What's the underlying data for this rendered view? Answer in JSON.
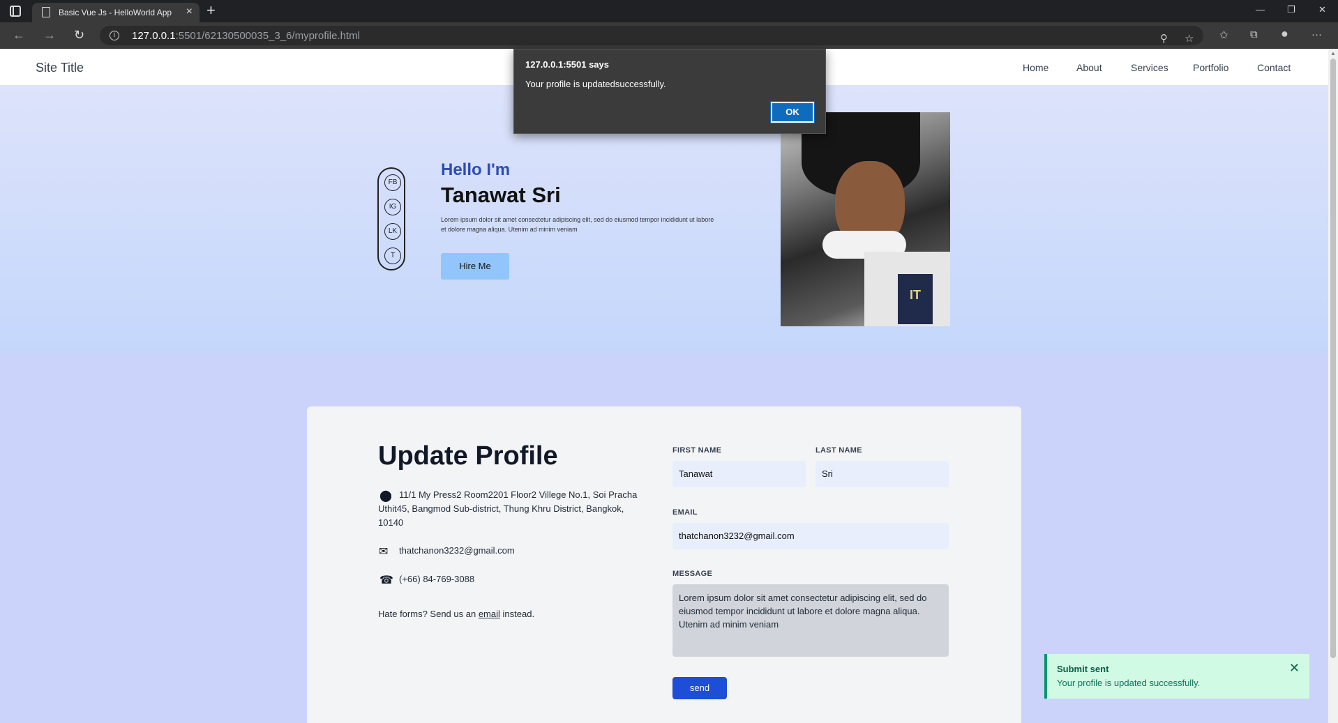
{
  "browser": {
    "tab_title": "Basic Vue Js - HelloWorld App",
    "url_host": "127.0.0.1",
    "url_rest": ":5501/62130500035_3_6/myprofile.html"
  },
  "nav": {
    "site_title": "Site Title",
    "links": [
      "Home",
      "About",
      "Services",
      "Portfolio",
      "Contact"
    ]
  },
  "hero": {
    "socials": [
      "FB",
      "IG",
      "LK",
      "T"
    ],
    "greeting": "Hello I'm",
    "name": "Tanawat Sri",
    "description": "Lorem ipsum dolor sit amet consectetur adipiscing elit, sed do eiusmod tempor incididunt ut labore et dolore magna aliqua. Utenim ad minim veniam",
    "hire_button": "Hire Me"
  },
  "form": {
    "title": "Update Profile",
    "address": "11/1 My Press2 Room2201 Floor2 Villege No.1, Soi Pracha Uthit45, Bangmod Sub-district, Thung Khru District, Bangkok, 10140",
    "email_info": "thatchanon3232@gmail.com",
    "phone": "(+66) 84-769-3088",
    "hate_prefix": "Hate forms? Send us an",
    "hate_link": "email",
    "hate_suffix": "instead.",
    "first_name_label": "FIRST NAME",
    "first_name_value": "Tanawat",
    "last_name_label": "LAST NAME",
    "last_name_value": "Sri",
    "email_label": "EMAIL",
    "email_value": "thatchanon3232@gmail.com",
    "message_label": "MESSAGE",
    "message_value": "Lorem ipsum dolor sit amet consectetur adipiscing elit, sed do eiusmod tempor incididunt ut labore et dolore magna aliqua. Utenim ad minim veniam",
    "send_button": "send"
  },
  "toast": {
    "title": "Submit sent",
    "message": "Your profile is updated successfully."
  },
  "alert": {
    "title": "127.0.0.1:5501 says",
    "message": "Your profile is updatedsuccessfully.",
    "ok": "OK"
  },
  "colors": {
    "accent": "#1d4ed8",
    "hello": "#2d4db4",
    "toast_bg": "#d1fae5"
  }
}
